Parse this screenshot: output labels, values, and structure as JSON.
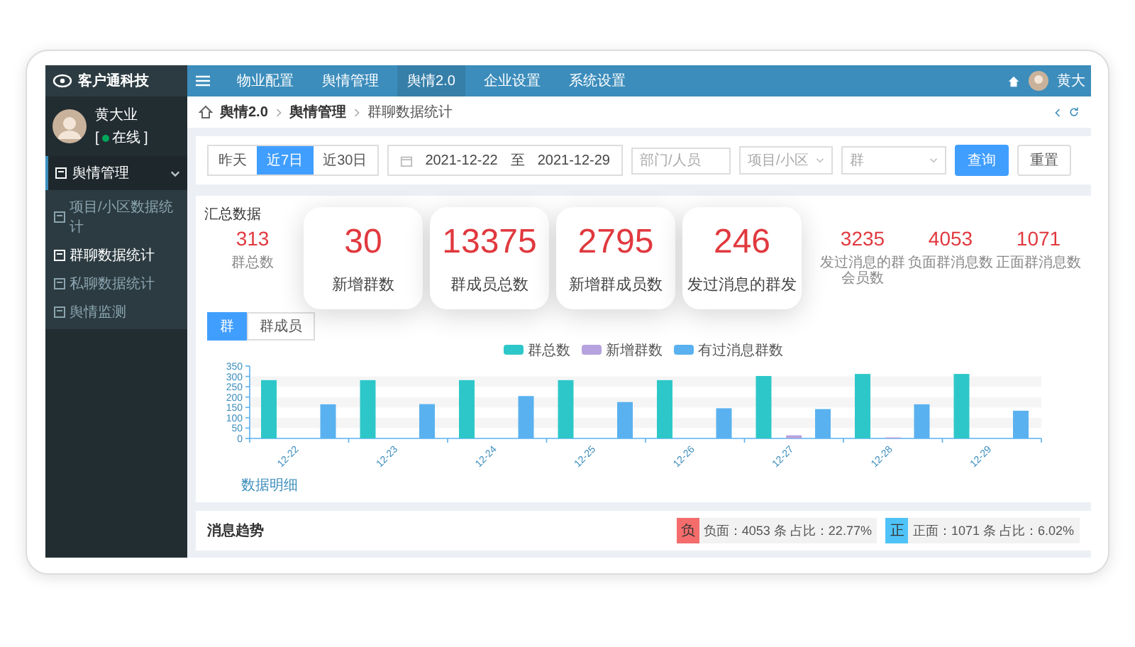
{
  "brand": {
    "name": "客户通科技"
  },
  "user": {
    "name": "黄大业",
    "status_open": "[",
    "status": "在线",
    "status_close": "]",
    "online": true
  },
  "sidebar": {
    "menu": [
      {
        "label": "舆情管理",
        "expanded": true,
        "children": [
          {
            "label": "项目/小区数据统计",
            "selected": false
          },
          {
            "label": "群聊数据统计",
            "selected": true
          },
          {
            "label": "私聊数据统计",
            "selected": false
          },
          {
            "label": "舆情监测",
            "selected": false
          }
        ]
      }
    ]
  },
  "topbar": {
    "nav": [
      {
        "label": "物业配置",
        "selected": false
      },
      {
        "label": "舆情管理",
        "selected": false
      },
      {
        "label": "舆情2.0",
        "selected": true
      },
      {
        "label": "企业设置",
        "selected": false
      },
      {
        "label": "系统设置",
        "selected": false
      }
    ],
    "user_short": "黄大"
  },
  "breadcrumb": [
    "舆情2.0",
    "舆情管理",
    "群聊数据统计"
  ],
  "filters": {
    "ranges": [
      {
        "label": "昨天",
        "selected": false
      },
      {
        "label": "近7日",
        "selected": true
      },
      {
        "label": "近30日",
        "selected": false
      }
    ],
    "date_start": "2021-12-22",
    "date_to": "至",
    "date_end": "2021-12-29",
    "person": {
      "placeholder": "部门/人员"
    },
    "project": {
      "placeholder": "项目/小区"
    },
    "group": {
      "placeholder": "群"
    },
    "buttons": [
      {
        "label": "查询",
        "kind": "primary"
      },
      {
        "label": "重置",
        "kind": "default"
      }
    ]
  },
  "summary": {
    "title": "汇总数据",
    "stats_left": [
      {
        "value": "313",
        "label": "群总数"
      }
    ],
    "stats_right": [
      {
        "value": "3235",
        "label": "发过消息的群会员数"
      },
      {
        "value": "4053",
        "label": "负面群消息数"
      },
      {
        "value": "1071",
        "label": "正面群消息数"
      }
    ],
    "highlight_cards": [
      {
        "value": "30",
        "label": "新增群数"
      },
      {
        "value": "13375",
        "label": "群成员总数"
      },
      {
        "value": "2795",
        "label": "新增群成员数"
      },
      {
        "value": "246",
        "label": "发过消息的群发"
      }
    ],
    "tabs": [
      {
        "label": "群",
        "selected": true
      },
      {
        "label": "群成员",
        "selected": false
      }
    ],
    "chart_data": {
      "type": "bar",
      "categories": [
        "12-22",
        "12-23",
        "12-24",
        "12-25",
        "12-26",
        "12-27",
        "12-28",
        "12-29"
      ],
      "series": [
        {
          "name": "群总数",
          "color": "#2ec7c9",
          "values": [
            282,
            282,
            282,
            282,
            282,
            302,
            312,
            312
          ]
        },
        {
          "name": "新增群数",
          "color": "#b6a2de",
          "values": [
            0,
            0,
            0,
            0,
            0,
            15,
            5,
            0
          ]
        },
        {
          "name": "有过消息群数",
          "color": "#5ab1ef",
          "values": [
            165,
            166,
            205,
            176,
            146,
            142,
            165,
            134
          ]
        }
      ],
      "ylim": [
        0,
        350
      ],
      "yticks": [
        0,
        50,
        100,
        150,
        200,
        250,
        300,
        350
      ]
    },
    "detail_link": "数据明细"
  },
  "trend": {
    "title": "消息趋势",
    "badges": [
      {
        "mark": "负",
        "color": "#f56c6c",
        "text": "负面：4053 条 占比：22.77%"
      },
      {
        "mark": "正",
        "color": "#4fc3f7",
        "text": "正面：1071 条 占比：6.02%"
      }
    ]
  }
}
